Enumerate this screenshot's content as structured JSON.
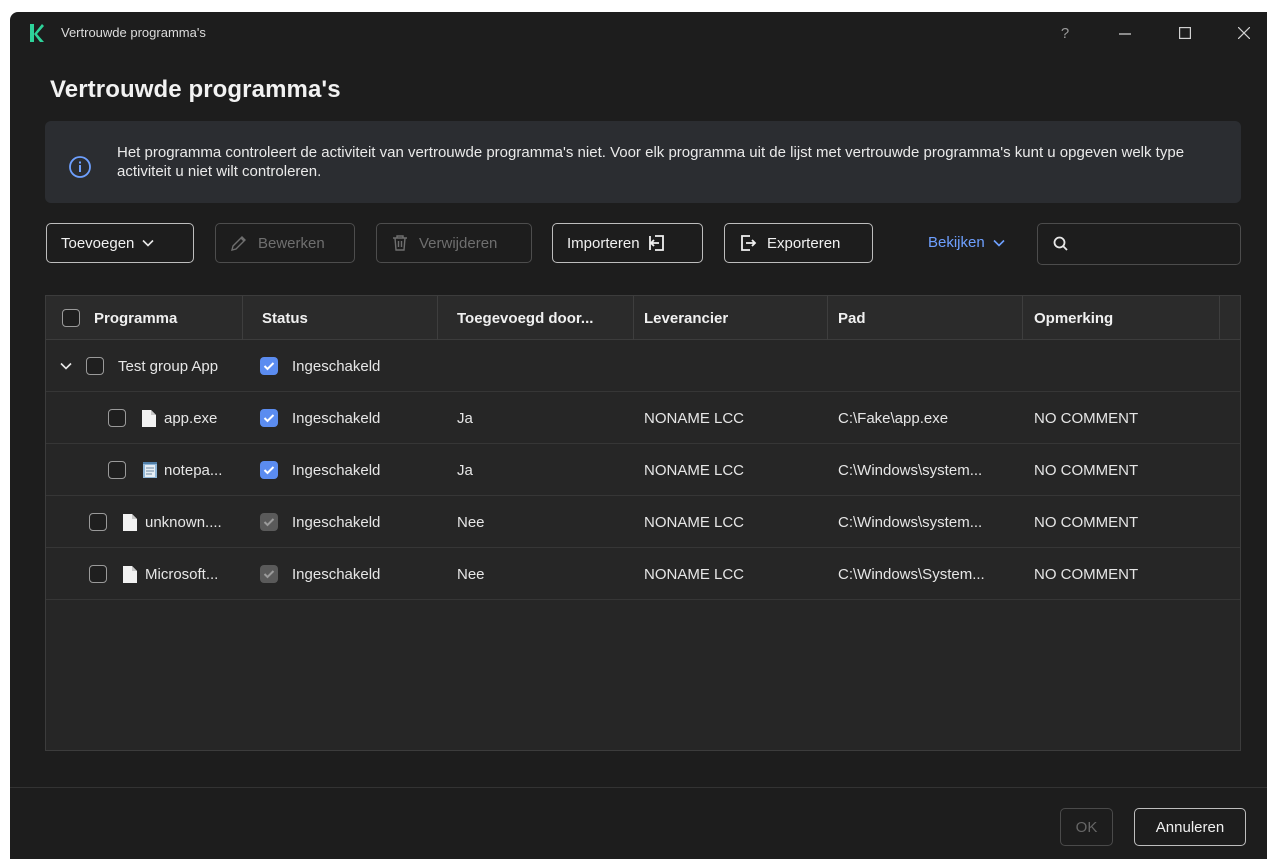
{
  "window": {
    "title": "Vertrouwde programma's",
    "help_label": "?",
    "accent": "#2ed39a"
  },
  "page_title": "Vertrouwde programma's",
  "banner": {
    "text": "Het programma controleert de activiteit van vertrouwde programma's niet. Voor elk programma uit de lijst met vertrouwde programma's kunt u opgeven welk type activiteit u niet wilt controleren.",
    "icon": "info-icon"
  },
  "toolbar": {
    "add": "Toevoegen",
    "edit": "Bewerken",
    "delete": "Verwijderen",
    "import": "Importeren",
    "export": "Exporteren",
    "view": "Bekijken",
    "search_placeholder": ""
  },
  "table": {
    "columns": [
      "Programma",
      "Status",
      "Toegevoegd door...",
      "Leverancier",
      "Pad",
      "Opmerking"
    ],
    "group": {
      "name": "Test group App",
      "status": "Ingeschakeld"
    },
    "rows": [
      {
        "name": "app.exe",
        "status": "Ingeschakeld",
        "added_by": "Ja",
        "vendor": "NONAME LCC",
        "path": "C:\\Fake\\app.exe",
        "comment": "NO COMMENT"
      },
      {
        "name": "notepa...",
        "status": "Ingeschakeld",
        "added_by": "Ja",
        "vendor": "NONAME LCC",
        "path": "C:\\Windows\\system...",
        "comment": "NO COMMENT"
      },
      {
        "name": "unknown....",
        "status": "Ingeschakeld",
        "added_by": "Nee",
        "vendor": "NONAME LCC",
        "path": "C:\\Windows\\system...",
        "comment": "NO COMMENT"
      },
      {
        "name": "Microsoft...",
        "status": "Ingeschakeld",
        "added_by": "Nee",
        "vendor": "NONAME LCC",
        "path": "C:\\Windows\\System...",
        "comment": "NO COMMENT"
      }
    ]
  },
  "footer": {
    "ok": "OK",
    "cancel": "Annuleren"
  },
  "colors": {
    "background": "#1d1d1d",
    "banner": "#2b2d31",
    "link": "#6ea0ff",
    "checkbox_checked": "#5b8cf0"
  }
}
